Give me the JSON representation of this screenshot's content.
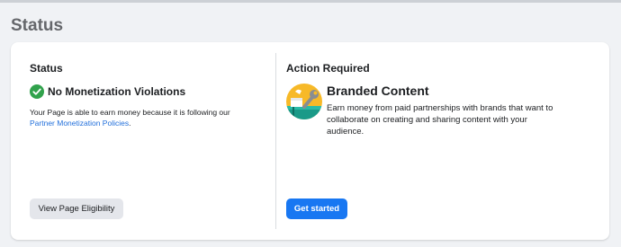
{
  "page": {
    "section_title": "Status"
  },
  "status_panel": {
    "title": "Status",
    "status_label": "No Monetization Violations",
    "status_icon": "check-circle-icon",
    "status_color": "#31a24c",
    "description_prefix": "Your Page is able to earn money because it is following our ",
    "policy_link": "Partner Monetization Policies",
    "description_suffix": ".",
    "button_label": "View Page Eligibility"
  },
  "action_panel": {
    "title": "Action Required",
    "feature_icon": "branded-content-icon",
    "feature_title": "Branded Content",
    "feature_description": "Earn money from paid partnerships with brands that want to collaborate on creating and sharing content with your audience.",
    "button_label": "Get started",
    "accent_color": "#1877f2"
  }
}
